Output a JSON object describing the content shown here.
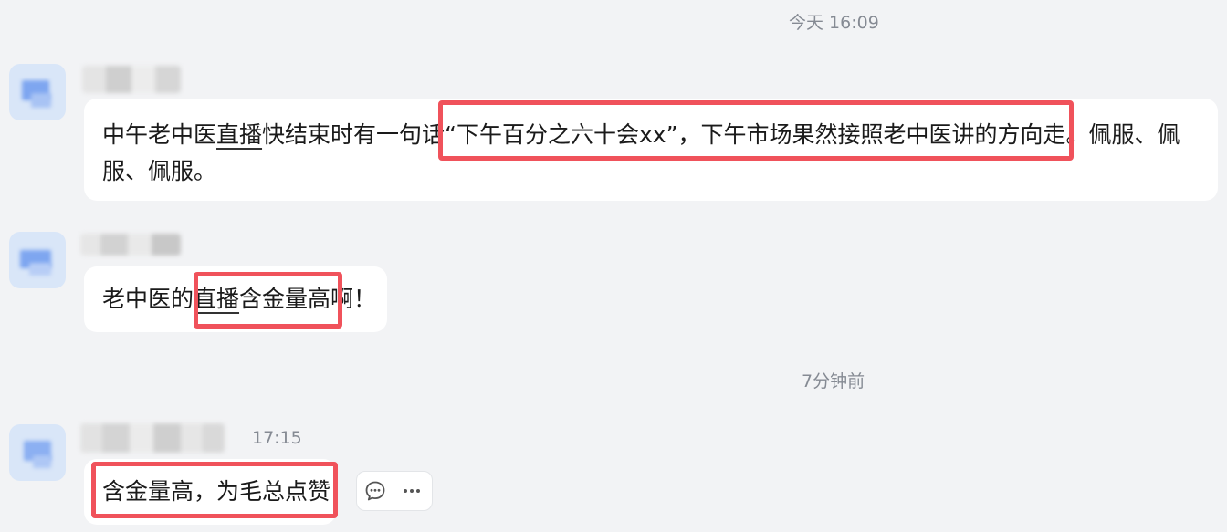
{
  "timestamps": {
    "top": "今天 16:09",
    "middle": "7分钟前"
  },
  "messages": [
    {
      "id": "msg1",
      "segments": [
        {
          "text": "中午老中医",
          "underline": false
        },
        {
          "text": "直播",
          "underline": true
        },
        {
          "text": "快结束时有一句话“下午百分之六十会xx”，下午市场果然接照老中医讲的方向走。佩服、佩服、佩服。",
          "underline": false
        }
      ]
    },
    {
      "id": "msg2",
      "segments": [
        {
          "text": "老中医的",
          "underline": false
        },
        {
          "text": "直播",
          "underline": true
        },
        {
          "text": "含金量高啊！",
          "underline": false
        }
      ]
    },
    {
      "id": "msg3",
      "time": "17:15",
      "segments": [
        {
          "text": "含金量高，为毛总点赞",
          "underline": false
        }
      ]
    }
  ],
  "icons": {
    "comment": "comment-bubble-icon",
    "more": "more-dots-icon"
  },
  "colors": {
    "background": "#f2f3f5",
    "bubble": "#ffffff",
    "highlight": "#f0525b",
    "timestamp": "#858a93",
    "avatar": "#d9e6f8"
  }
}
